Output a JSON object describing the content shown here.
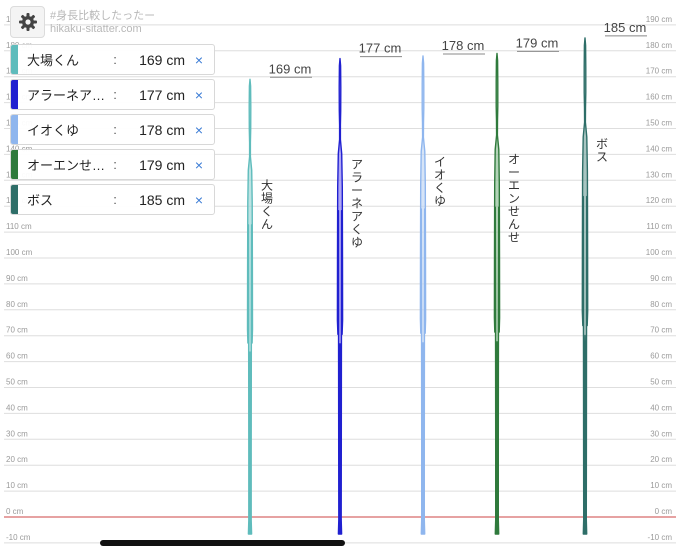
{
  "watermark": {
    "title": "#身長比較したったー",
    "url": "hikaku-sitatter.com"
  },
  "chart_data": {
    "type": "height-comparison",
    "unit": "cm",
    "axis_min": -10,
    "axis_max": 190,
    "tick_step": 10,
    "baseline_color": "#d86a6a",
    "characters": [
      {
        "name": "大場くん",
        "display_name": "大場くん",
        "height": 169,
        "height_label": "169 cm",
        "color": "#5fbcbc",
        "fill": "#9ed6d6"
      },
      {
        "name": "アラーネアくゆ",
        "display_name": "アラーネア…",
        "height": 177,
        "height_label": "177 cm",
        "color": "#2020d0",
        "fill": "#8a7ff0"
      },
      {
        "name": "イオくゆ",
        "display_name": "イオくゆ",
        "height": 178,
        "height_label": "178 cm",
        "color": "#8fb6ee",
        "fill": "#c3d7f3"
      },
      {
        "name": "オーエンせんせ",
        "display_name": "オーエンせ…",
        "height": 179,
        "height_label": "179 cm",
        "color": "#2f7a3c",
        "fill": "#8fbf97"
      },
      {
        "name": "ボス",
        "display_name": "ボス",
        "height": 185,
        "height_label": "185 cm",
        "color": "#2e6e68",
        "fill": "#7fa9a3"
      }
    ]
  },
  "ui": {
    "colon": ":",
    "remove_glyph": "×"
  }
}
